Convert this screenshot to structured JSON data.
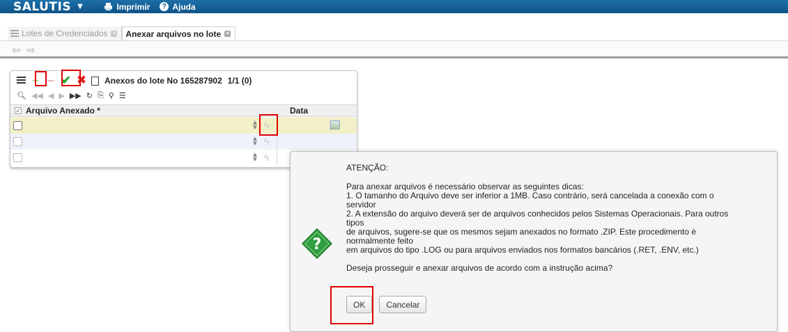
{
  "topbar": {
    "brand": "SALUTIS",
    "brand_caret": "▼",
    "print_label": "Imprimir",
    "help_label": "Ajuda"
  },
  "tabs": [
    {
      "label": "Lotes de Credenciados",
      "active": false
    },
    {
      "label": "Anexar arquivos no lote",
      "active": true
    }
  ],
  "nav": {
    "back": "⇦",
    "forward": "⇨"
  },
  "panel": {
    "title": "Anexos do lote No 165287902",
    "page_info": "1/1 (0)",
    "columns": [
      "Arquivo Anexado *",
      "Data"
    ],
    "rows": [
      {
        "checked": false,
        "highlighted": true
      },
      {
        "checked": false,
        "highlighted": false
      },
      {
        "checked": false,
        "highlighted": false
      }
    ],
    "toolbar_icons": [
      "list-icon",
      "add-icon",
      "remove-icon",
      "confirm-icon",
      "cancel-icon",
      "document-icon"
    ],
    "toolbar2_icons": [
      "search-icon",
      "first-page-icon",
      "prev-page-icon",
      "next-page-icon",
      "last-page-icon",
      "refresh-icon",
      "export-icon",
      "tools-icon",
      "list-settings-icon"
    ]
  },
  "dialog": {
    "heading": "ATENÇÃO:",
    "lines": [
      "Para anexar arquivos é necessário observar as seguintes dicas:",
      "1. O tamanho do Arquivo deve ser inferior a 1MB. Caso contrário, será cancelada a conexão com o",
      "servidor",
      "2. A extensão do arquivo deverá ser de arquivos conhecidos pelos Sistemas Operacionais. Para outros",
      "tipos",
      "de arquivos, sugere-se que os mesmos sejam anexados no formato .ZIP. Este procedimento é",
      "normalmente feito",
      "em arquivos do tipo .LOG ou para arquivos enviados nos formatos bancários (.RET, .ENV, etc.)"
    ],
    "question": "Deseja prosseguir e anexar arquivos de acordo com a instrução acima?",
    "ok_label": "OK",
    "cancel_label": "Cancelar"
  },
  "colors": {
    "topbar": "#0f5489",
    "row_highlight": "#f2f0c6",
    "row_alt": "#eef2fb",
    "highlight_box": "#e00000",
    "dialog_icon": "#2e9e3e"
  }
}
